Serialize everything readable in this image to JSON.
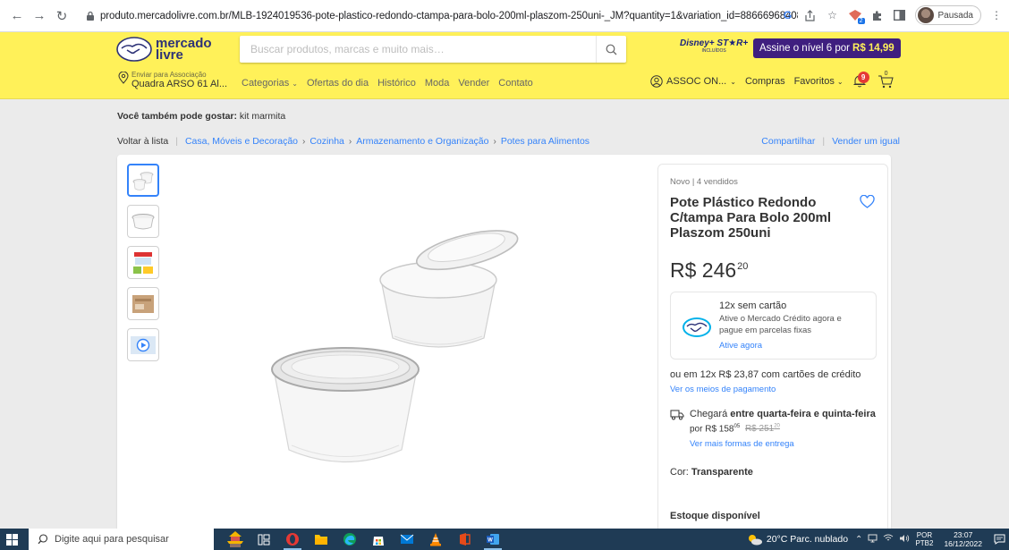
{
  "browser": {
    "url": "produto.mercadolivre.com.br/MLB-1924019536-pote-plastico-redondo-ctampa-para-bolo-200ml-plaszom-250uni-_JM?quantity=1&variation_id=88666968408",
    "profile_label": "Pausada",
    "ext_badge": "2"
  },
  "header": {
    "logo_line1": "mercado",
    "logo_line2": "livre",
    "search_placeholder": "Buscar produtos, marcas e muito mais…",
    "disney_line1": "Disney+ ST★R+",
    "disney_line2": "INCLUÍDOS",
    "promo_text": "Assine o nível 6 por",
    "promo_price": "R$ 14,99",
    "address_line1": "Enviar para Associação",
    "address_line2": "Quadra ARSO 61 Al...",
    "categories": [
      "Categorias",
      "Ofertas do dia",
      "Histórico",
      "Moda",
      "Vender",
      "Contato"
    ],
    "account": "ASSOC ON...",
    "purchases": "Compras",
    "favorites": "Favoritos",
    "notif_count": "9",
    "cart_count": "0"
  },
  "page": {
    "suggest_label": "Você também pode gostar:",
    "suggest_value": "kit marmita",
    "back": "Voltar à lista",
    "breadcrumbs": [
      "Casa, Móveis e Decoração",
      "Cozinha",
      "Armazenamento e Organização",
      "Potes para Alimentos"
    ],
    "share": "Compartilhar",
    "sell_same": "Vender um igual"
  },
  "product": {
    "condition": "Novo  |  4 vendidos",
    "title": "Pote Plástico Redondo C/tampa Para Bolo 200ml Plaszom 250uni",
    "price_int": "R$ 246",
    "price_cents": "20",
    "credit_title": "12x sem cartão",
    "credit_desc": "Ative o Mercado Crédito agora e pague em parcelas fixas",
    "credit_link": "Ative agora",
    "installments": "ou em 12x R$ 23,87 com cartões de crédito",
    "payment_link": "Ver os meios de pagamento",
    "ship_prefix": "Chegará",
    "ship_dates": "entre quarta-feira e quinta-feira",
    "ship_price_prefix": "por R$ 158",
    "ship_price_cents": "05",
    "ship_old_price": "R$ 251",
    "ship_old_cents": "20",
    "ship_link": "Ver mais formas de entrega",
    "color_label": "Cor:",
    "color_value": "Transparente",
    "stock": "Estoque disponível"
  },
  "taskbar": {
    "search_placeholder": "Digite aqui para pesquisar",
    "weather": "20°C  Parc. nublado",
    "lang1": "POR",
    "lang2": "PTB2",
    "time": "23:07",
    "date": "16/12/2022"
  },
  "colors": {
    "ml_yellow": "#fff159",
    "ml_blue": "#3483fa",
    "promo_purple": "#3f1f7f",
    "taskbar": "#1f3b55"
  }
}
